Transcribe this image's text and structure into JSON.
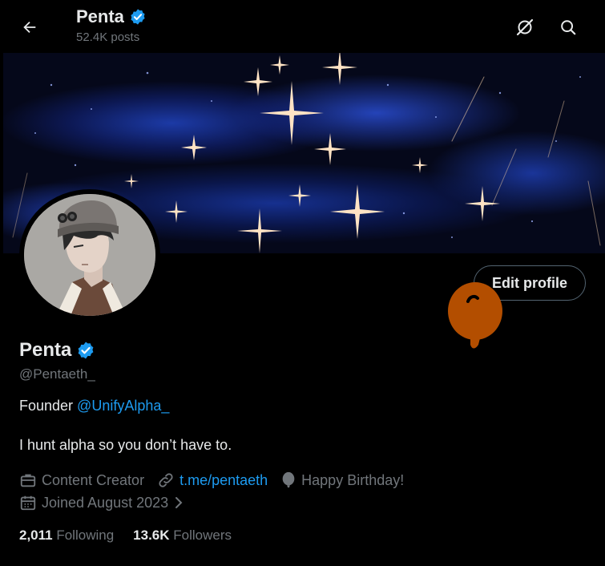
{
  "header": {
    "name": "Penta",
    "posts": "52.4K posts",
    "icons": [
      "back-arrow-icon",
      "grok-icon",
      "search-icon"
    ]
  },
  "colors": {
    "accent": "#1d9bf0",
    "text_primary": "#e7e9ea",
    "text_secondary": "#71767b",
    "balloon": "#b34e00"
  },
  "profile": {
    "name": "Penta",
    "handle": "@Pentaeth_",
    "edit_label": "Edit profile",
    "bio_prefix": "Founder ",
    "bio_mention": "@UnifyAlpha_",
    "bio_line2": "I hunt alpha so you don’t have to.",
    "category": "Content Creator",
    "link": "t.me/pentaeth",
    "birthday": "Happy Birthday!",
    "joined": "Joined August 2023"
  },
  "stats": {
    "following_count": "2,011",
    "following_label": "Following",
    "followers_count": "13.6K",
    "followers_label": "Followers"
  }
}
